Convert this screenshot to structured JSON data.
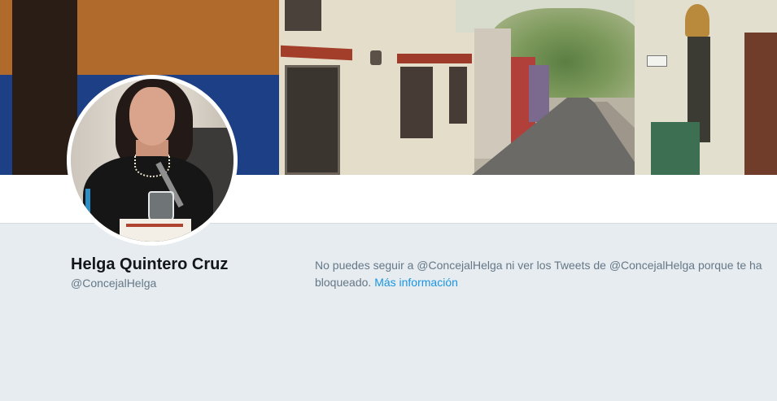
{
  "profile": {
    "display_name": "Helga Quintero Cruz",
    "handle": "@ConcejalHelga"
  },
  "blocked_notice": {
    "text": "No puedes seguir a @ConcejalHelga ni ver los Tweets de @ConcejalHelga porque te ha bloqueado.",
    "link_label": "Más información"
  },
  "colors": {
    "page_background": "#e6ecf0",
    "link": "#1b95e0",
    "secondary_text": "#657786",
    "primary_text": "#14171a"
  }
}
